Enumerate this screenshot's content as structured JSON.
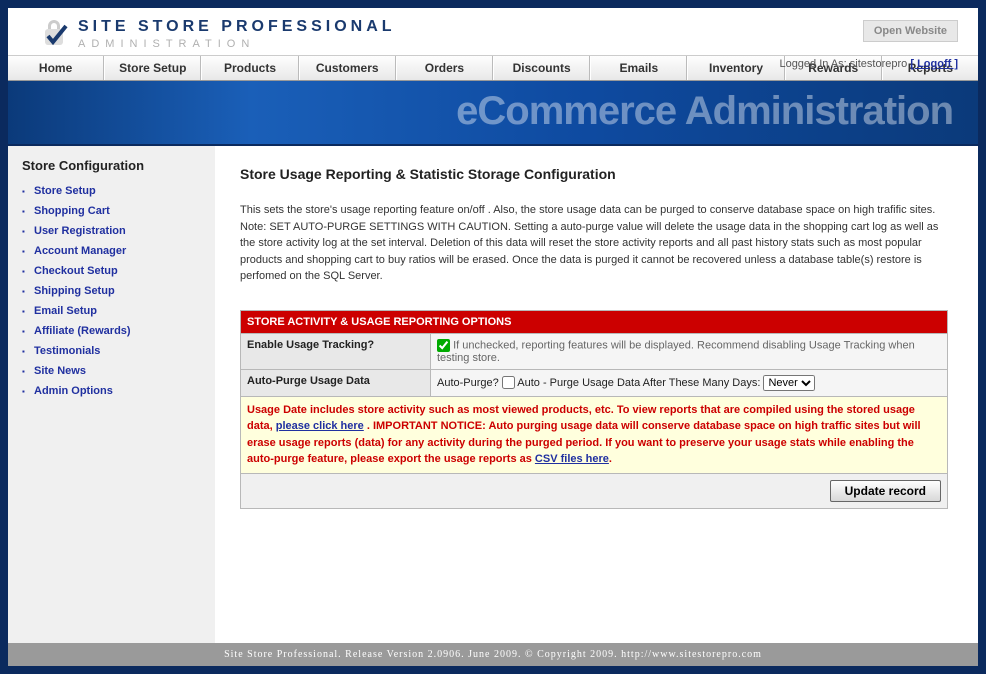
{
  "header": {
    "title_line1": "SITE STORE PROFESSIONAL",
    "title_line2": "ADMINISTRATION",
    "open_website": "Open Website",
    "logged_in_prefix": "Logged In As: ",
    "logged_in_user": "sitestorepro",
    "logoff_label": "[ Logoff ]"
  },
  "nav": {
    "items": [
      "Home",
      "Store Setup",
      "Products",
      "Customers",
      "Orders",
      "Discounts",
      "Emails",
      "Inventory",
      "Rewards",
      "Reports"
    ]
  },
  "banner": {
    "text": "eCommerce Administration"
  },
  "sidebar": {
    "title": "Store Configuration",
    "items": [
      "Store Setup",
      "Shopping Cart",
      "User Registration",
      "Account Manager",
      "Checkout Setup",
      "Shipping Setup",
      "Email Setup",
      "Affiliate (Rewards)",
      "Testimonials",
      "Site News",
      "Admin Options"
    ]
  },
  "main": {
    "title": "Store Usage Reporting & Statistic Storage Configuration",
    "intro": "This sets the store's usage reporting feature on/off . Also, the store usage data can be purged to conserve database space on high trafific sites. Note: SET AUTO-PURGE SETTINGS WITH CAUTION. Setting a auto-purge value will delete the usage data in the shopping cart log as well as the store activity log at the set interval. Deletion of this data will reset the store activity reports and all past history stats such as most popular products and shopping cart to buy ratios will be erased. Once the data is purged it cannot be recovered unless a database table(s) restore is perfomed on the SQL Server.",
    "options_header": "STORE ACTIVITY & USAGE REPORTING OPTIONS",
    "row1_label": "Enable Usage Tracking?",
    "row1_hint": "If unchecked, reporting features will be displayed. Recommend disabling Usage Tracking when testing store.",
    "row2_label": "Auto-Purge Usage Data",
    "row2_prefix": "Auto-Purge? ",
    "row2_mid": " Auto - Purge Usage Data After These Many Days: ",
    "row2_select": "Never",
    "notice_part1": "Usage Date includes store activity such as most viewed products, etc. To view reports that are compiled using the stored usage data, ",
    "notice_link1": "please click here",
    "notice_part2": " . IMPORTANT NOTICE: Auto purging usage data will conserve database space on high traffic sites but will erase usage reports (data) for any activity during the purged period. If you want to preserve your usage stats while enabling the auto-purge feature, please export the usage reports as ",
    "notice_link2": "CSV files here",
    "notice_part3": ".",
    "update_btn": "Update record"
  },
  "footer": {
    "text": "Site Store Professional. Release Version 2.0906. June 2009. © Copyright 2009. http://www.sitestorepro.com"
  }
}
